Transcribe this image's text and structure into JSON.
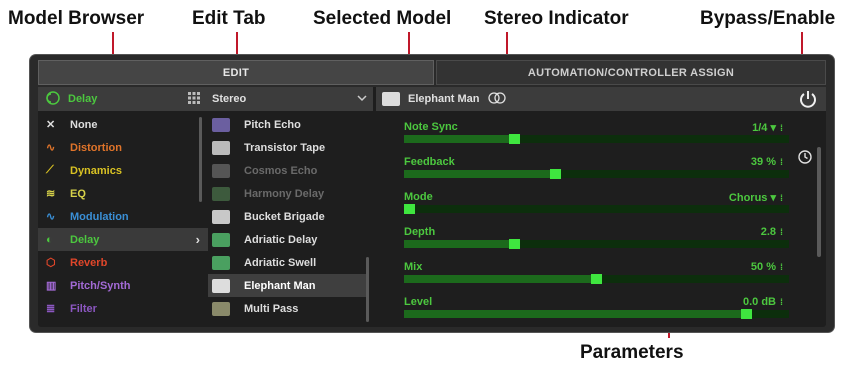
{
  "callouts": {
    "model_browser": "Model Browser",
    "edit_tab": "Edit Tab",
    "selected_model": "Selected Model",
    "stereo_indicator": "Stereo Indicator",
    "bypass_enable": "Bypass/Enable",
    "parameters": "Parameters"
  },
  "tabs": {
    "edit": "EDIT",
    "automation": "AUTOMATION/CONTROLLER ASSIGN"
  },
  "header": {
    "category": "Delay",
    "subcategory": "Stereo",
    "selected_model": "Elephant Man"
  },
  "categories": [
    {
      "label": "None",
      "color": "#dedede",
      "icon": "none-icon"
    },
    {
      "label": "Distortion",
      "color": "#e0742a",
      "icon": "distortion-icon"
    },
    {
      "label": "Dynamics",
      "color": "#d9c223",
      "icon": "dynamics-icon"
    },
    {
      "label": "EQ",
      "color": "#d7d24a",
      "icon": "eq-icon"
    },
    {
      "label": "Modulation",
      "color": "#3a8fd6",
      "icon": "modulation-icon"
    },
    {
      "label": "Delay",
      "color": "#4cc83f",
      "icon": "delay-icon"
    },
    {
      "label": "Reverb",
      "color": "#e0462a",
      "icon": "reverb-icon"
    },
    {
      "label": "Pitch/Synth",
      "color": "#a36ad6",
      "icon": "pitch-synth-icon"
    },
    {
      "label": "Filter",
      "color": "#8c57c2",
      "icon": "filter-icon"
    }
  ],
  "models": [
    {
      "label": "Pitch Echo",
      "dim": false,
      "pedal_color": "#6b5fa0"
    },
    {
      "label": "Transistor Tape",
      "dim": false,
      "pedal_color": "#bbbbbb"
    },
    {
      "label": "Cosmos Echo",
      "dim": true,
      "pedal_color": "#555555"
    },
    {
      "label": "Harmony Delay",
      "dim": true,
      "pedal_color": "#3d5a3d"
    },
    {
      "label": "Bucket Brigade",
      "dim": false,
      "pedal_color": "#c8c8c8"
    },
    {
      "label": "Adriatic Delay",
      "dim": false,
      "pedal_color": "#4aa060"
    },
    {
      "label": "Adriatic Swell",
      "dim": false,
      "pedal_color": "#4aa060"
    },
    {
      "label": "Elephant Man",
      "dim": false,
      "pedal_color": "#dddddd"
    },
    {
      "label": "Multi Pass",
      "dim": false,
      "pedal_color": "#8a8a6a"
    }
  ],
  "parameters": [
    {
      "label": "Note Sync",
      "value": "1/4 ▾",
      "level": 0.28
    },
    {
      "label": "Feedback",
      "value": "39 %",
      "level": 0.39
    },
    {
      "label": "Mode",
      "value": "Chorus ▾",
      "level": 0.0
    },
    {
      "label": "Depth",
      "value": "2.8",
      "level": 0.28
    },
    {
      "label": "Mix",
      "value": "50 %",
      "level": 0.5
    },
    {
      "label": "Level",
      "value": "0.0 dB",
      "level": 0.9
    }
  ],
  "colors": {
    "accent": "#4cc83f",
    "callout_red": "#c0182a"
  }
}
